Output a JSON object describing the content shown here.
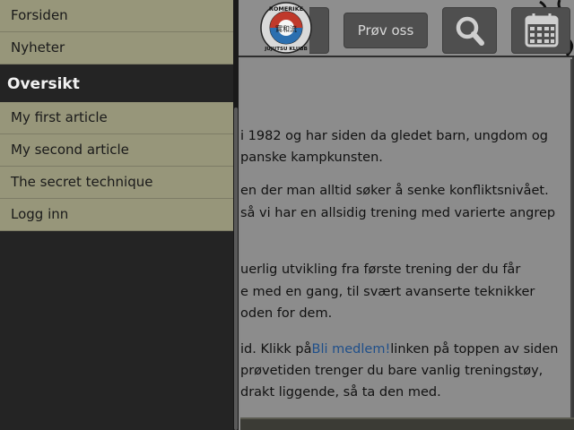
{
  "sidebar": {
    "items_top": [
      {
        "label": "Forsiden"
      },
      {
        "label": "Nyheter"
      }
    ],
    "header": "Oversikt",
    "items": [
      {
        "label": "My first article"
      },
      {
        "label": "My second article"
      },
      {
        "label": "The secret technique"
      },
      {
        "label": "Logg inn"
      }
    ]
  },
  "header": {
    "logo": {
      "text_top": "ROMERIKE",
      "text_bottom": "JUJUTSU KLUBB",
      "kanji": "實和流"
    },
    "try_button": "Prøv oss",
    "search_icon": "search-icon",
    "calendar_icon": "calendar-icon"
  },
  "content": {
    "lines": [
      "i 1982 og har siden da gledet barn, ungdom og",
      "panske kampkunsten.",
      "en der man alltid søker å senke konfliktsnivået.",
      "så vi har en allsidig trening med varierte angrep",
      "uerlig utvikling fra første trening der du får",
      "e med en gang, til svært avanserte teknikker",
      "oden for dem."
    ],
    "link_line_prefix": "id. Klikk på",
    "link_text": "Bli medlem!",
    "link_line_suffix": "linken på toppen av siden",
    "lines_after": [
      " prøvetiden trenger du bare vanlig treningstøy,",
      " drakt liggende, så ta den med."
    ]
  },
  "colors": {
    "menu_item_bg": "#97967a",
    "sidebar_bg": "#242424",
    "link": "#1f4f8a"
  }
}
